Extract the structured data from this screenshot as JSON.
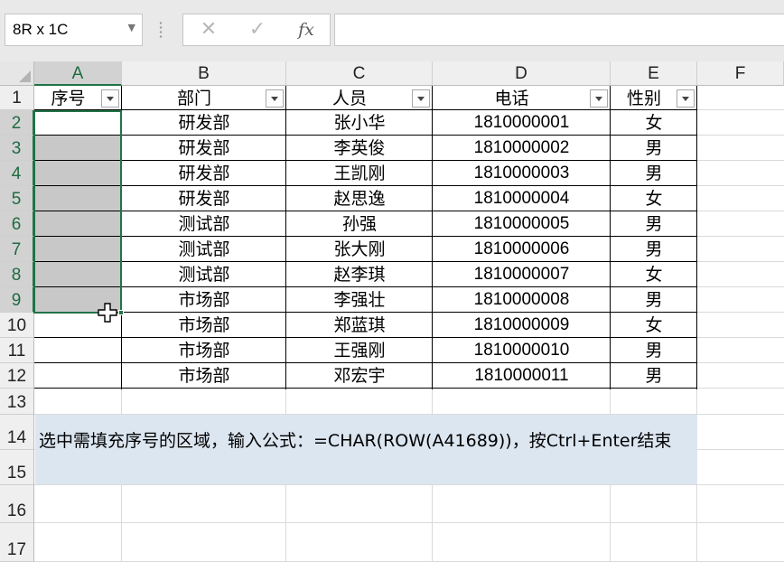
{
  "name_box": {
    "value": "8R x 1C"
  },
  "formula_bar": {
    "value": "",
    "icons": [
      "close-icon",
      "check-icon",
      "function-icon"
    ],
    "fx_label": "fx"
  },
  "columns": [
    "A",
    "B",
    "C",
    "D",
    "E",
    "F"
  ],
  "rows": [
    "1",
    "2",
    "3",
    "4",
    "5",
    "6",
    "7",
    "8",
    "9",
    "10",
    "11",
    "12",
    "13",
    "14",
    "15",
    "16",
    "17"
  ],
  "table": {
    "headers": [
      "序号",
      "部门",
      "人员",
      "电话",
      "性别"
    ],
    "rows": [
      [
        "",
        "研发部",
        "张小华",
        "1810000001",
        "女"
      ],
      [
        "",
        "研发部",
        "李英俊",
        "1810000002",
        "男"
      ],
      [
        "",
        "研发部",
        "王凯刚",
        "1810000003",
        "男"
      ],
      [
        "",
        "研发部",
        "赵思逸",
        "1810000004",
        "女"
      ],
      [
        "",
        "测试部",
        "孙强",
        "1810000005",
        "男"
      ],
      [
        "",
        "测试部",
        "张大刚",
        "1810000006",
        "男"
      ],
      [
        "",
        "测试部",
        "赵李琪",
        "1810000007",
        "女"
      ],
      [
        "",
        "市场部",
        "李强壮",
        "1810000008",
        "男"
      ],
      [
        "",
        "市场部",
        "郑蓝琪",
        "1810000009",
        "女"
      ],
      [
        "",
        "市场部",
        "王强刚",
        "1810000010",
        "男"
      ],
      [
        "",
        "市场部",
        "邓宏宇",
        "1810000011",
        "男"
      ]
    ]
  },
  "note": "选中需填充序号的区域，输入公式：=CHAR(ROW(A41689))，按Ctrl+Enter结束",
  "colors": {
    "accent": "#217346",
    "selection": "#c8c8c8",
    "note_bg": "#dce6f1"
  }
}
